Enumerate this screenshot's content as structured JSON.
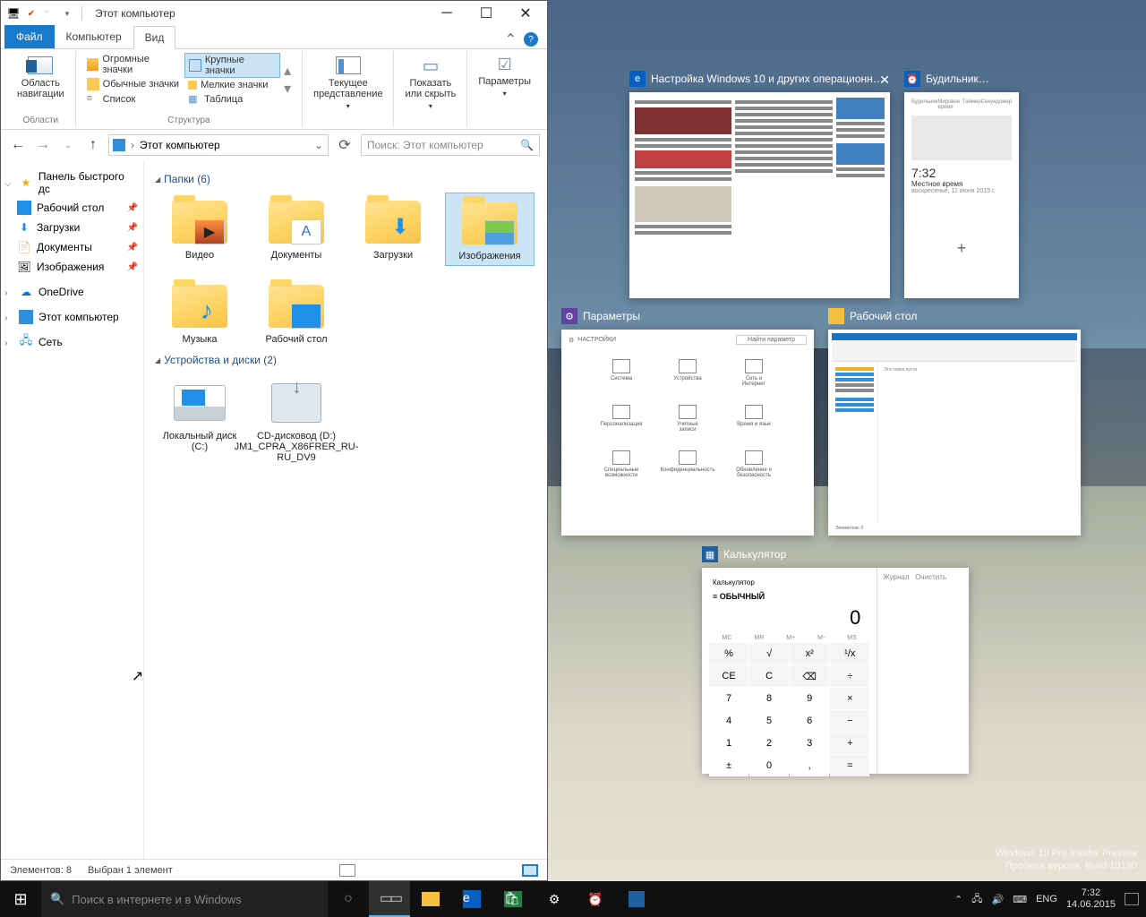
{
  "explorer": {
    "title": "Этот компьютер",
    "tabs": {
      "file": "Файл",
      "computer": "Компьютер",
      "view": "Вид"
    },
    "ribbon": {
      "nav_pane": "Область\nнавигации",
      "group_panes": "Области",
      "sizes": {
        "huge": "Огромные значки",
        "large": "Крупные значки",
        "normal": "Обычные значки",
        "small": "Мелкие значки",
        "list": "Список",
        "table": "Таблица"
      },
      "group_layout": "Структура",
      "current_view": "Текущее\nпредставление",
      "show_hide": "Показать\nили скрыть",
      "options": "Параметры"
    },
    "address": "Этот компьютер",
    "search_ph": "Поиск: Этот компьютер",
    "sidebar": {
      "quick": "Панель быстрого дс",
      "desktop": "Рабочий стол",
      "downloads": "Загрузки",
      "documents": "Документы",
      "pictures": "Изображения",
      "onedrive": "OneDrive",
      "thispc": "Этот компьютер",
      "network": "Сеть"
    },
    "groups": {
      "folders": "Папки (6)",
      "devices": "Устройства и диски (2)"
    },
    "items": {
      "video": "Видео",
      "documents": "Документы",
      "downloads": "Загрузки",
      "pictures": "Изображения",
      "music": "Музыка",
      "desktop": "Рабочий стол",
      "local_disk": "Локальный диск (C:)",
      "dvd": "CD-дисковод (D:) JM1_CPRA_X86FRER_RU-RU_DV9"
    },
    "status": {
      "count": "Элементов: 8",
      "selected": "Выбран 1 элемент"
    }
  },
  "thumbs": {
    "t1": "Настройка Windows 10 и других операционн…",
    "t2": "Будильник…",
    "t2_time": "7:32",
    "t2_loc": "Местное время",
    "t2_date": "воскресенье, 11 июня 2015 г.",
    "t3": "Параметры",
    "t3_hdr": "НАСТРОЙКИ",
    "t4": "Рабочий стол",
    "t5": "Калькулятор",
    "calc": {
      "title": "Калькулятор",
      "mode": "ОБЫЧНЫЙ",
      "display": "0",
      "hist": "Журнал",
      "mem_clr": "Очистить",
      "mem": [
        "MC",
        "MR",
        "M+",
        "M-",
        "MS"
      ],
      "keys": [
        "%",
        "√",
        "x²",
        "¹/x",
        "CE",
        "C",
        "⌫",
        "÷",
        "7",
        "8",
        "9",
        "×",
        "4",
        "5",
        "6",
        "−",
        "1",
        "2",
        "3",
        "+",
        "±",
        "0",
        ",",
        "="
      ]
    }
  },
  "taskbar": {
    "search_ph": "Поиск в интернете и в Windows",
    "lang": "ENG",
    "time": "7:32",
    "date": "14.06.2015"
  },
  "watermark": {
    "l1": "Windows 10 Pro Insider Preview",
    "l2": "Пробная версия. Build 10130"
  }
}
